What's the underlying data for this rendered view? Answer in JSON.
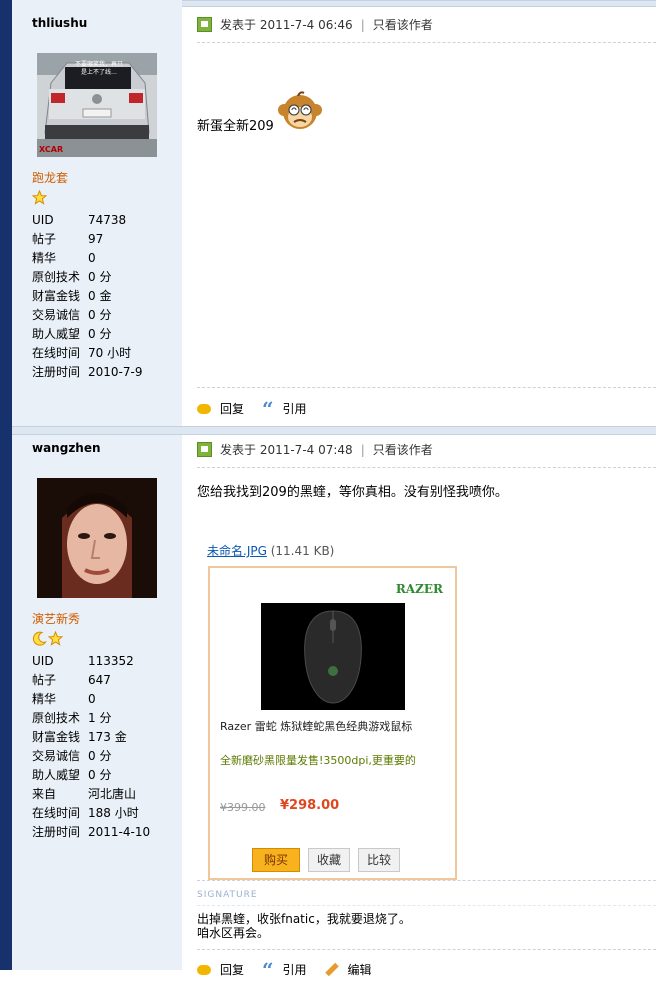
{
  "posts": [
    {
      "author": "thliushu",
      "rank": "跑龙套",
      "stars": [
        "star"
      ],
      "stats": [
        {
          "k": "UID",
          "v": "74738"
        },
        {
          "k": "帖子",
          "v": "97"
        },
        {
          "k": "精华",
          "v": "0"
        },
        {
          "k": "原创技术",
          "v": "0 分"
        },
        {
          "k": "财富金钱",
          "v": "0 金"
        },
        {
          "k": "交易诚信",
          "v": "0 分"
        },
        {
          "k": "助人威望",
          "v": "0 分"
        },
        {
          "k": "在线时间",
          "v": "70 小时"
        },
        {
          "k": "注册时间",
          "v": "2010-7-9"
        }
      ],
      "posted_at": "发表于 2011-7-4 06:46",
      "only_author": "只看该作者",
      "content": "新蛋全新209",
      "avatar_text": "不要嘲笑我，再只是上不了线…",
      "avatar_badge": "XCAR"
    },
    {
      "author": "wangzhen",
      "rank": "演艺新秀",
      "stars": [
        "moon",
        "star"
      ],
      "stats": [
        {
          "k": "UID",
          "v": "113352"
        },
        {
          "k": "帖子",
          "v": "647"
        },
        {
          "k": "精华",
          "v": "0"
        },
        {
          "k": "原创技术",
          "v": "1 分"
        },
        {
          "k": "财富金钱",
          "v": "173 金"
        },
        {
          "k": "交易诚信",
          "v": "0 分"
        },
        {
          "k": "助人威望",
          "v": "0 分"
        },
        {
          "k": "来自",
          "v": "河北唐山"
        },
        {
          "k": "在线时间",
          "v": "188 小时"
        },
        {
          "k": "注册时间",
          "v": "2011-4-10"
        }
      ],
      "posted_at": "发表于 2011-7-4 07:48",
      "only_author": "只看该作者",
      "content": "您给我找到209的黑蝰，等你真相。没有别怪我喷你。",
      "attachment": {
        "name": "未命名.JPG",
        "size": "(11.41 KB)"
      },
      "product": {
        "brand": "RAZER",
        "name": "Razer 雷蛇 炼狱蝰蛇黑色经典游戏鼠标",
        "desc": "全新磨砂黑限量发售!3500dpi,更重要的",
        "old_price": "¥399.00",
        "price": "¥298.00",
        "buttons": [
          "购买",
          "收藏",
          "比较"
        ]
      },
      "signature_title": "SIGNATURE",
      "signature": [
        "出掉黑蝰，收张fnatic，我就要退烧了。",
        "咱水区再会。"
      ]
    }
  ],
  "actions": {
    "reply": "回复",
    "quote": "引用",
    "edit": "编辑"
  },
  "colors": {
    "left_bar": "#16316b",
    "sidebar_bg": "#e9f0f7",
    "rank": "#d05e00",
    "link": "#0a58b0",
    "price": "#e0471f"
  }
}
